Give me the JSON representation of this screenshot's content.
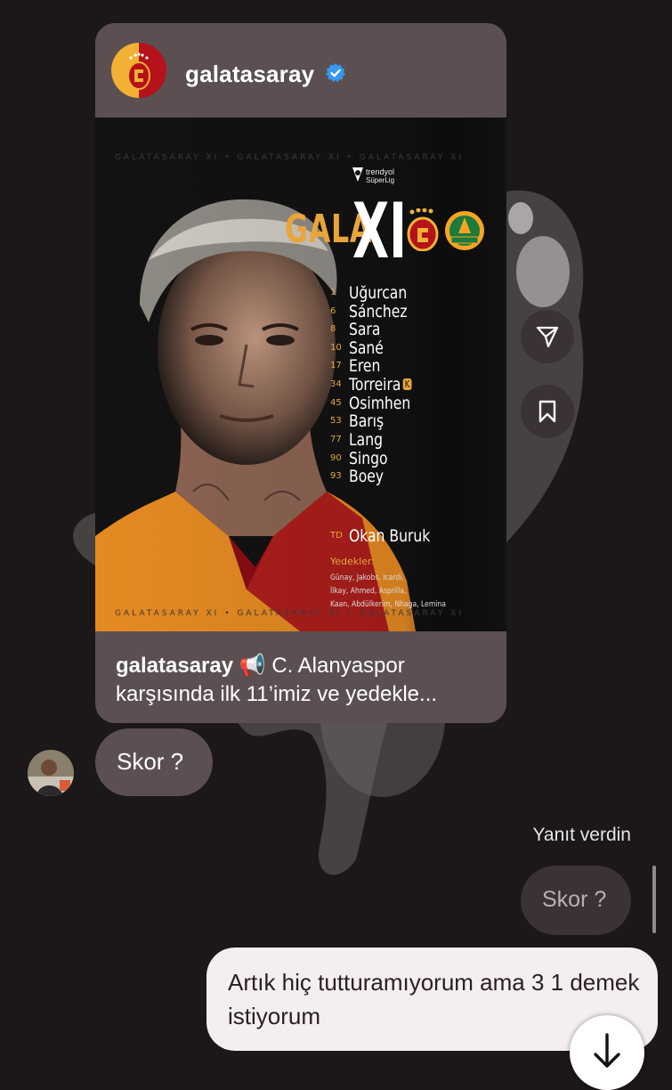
{
  "post": {
    "username": "galatasaray",
    "caption_user": "galatasaray",
    "caption_text": " 📢 C. Alanyaspor karşısında ilk 11’imiz ve yedekle..."
  },
  "graphic": {
    "watermark": "GALATASARAY XI   •   GALATASARAY XI   •   GALATASARAY XI",
    "league_line1": "trendyol",
    "league_line2": "SüperLig",
    "title_gala": "GALA",
    "title_xi": "XI",
    "away_crest_text": "ALANYASPOR",
    "lineup": [
      {
        "num": "1",
        "name": "Uğurcan"
      },
      {
        "num": "6",
        "name": "Sánchez"
      },
      {
        "num": "8",
        "name": "Sara"
      },
      {
        "num": "10",
        "name": "Sané"
      },
      {
        "num": "17",
        "name": "Eren"
      },
      {
        "num": "34",
        "name": "Torreira",
        "captain": "K"
      },
      {
        "num": "45",
        "name": "Osimhen"
      },
      {
        "num": "53",
        "name": "Barış"
      },
      {
        "num": "77",
        "name": "Lang"
      },
      {
        "num": "90",
        "name": "Singo"
      },
      {
        "num": "93",
        "name": "Boey"
      }
    ],
    "coach_label": "TD",
    "coach_name": "Okan Buruk",
    "subs_title": "Yedekler:",
    "subs": [
      "Günay, Jakobs, Icardi,",
      "İlkay, Ahmed, Asprilla,",
      "Kaan, Abdülkerim, Nhaga, Lemina"
    ],
    "colors": {
      "gold": "#e8a53a",
      "red": "#b5121b"
    }
  },
  "side_actions": [
    {
      "icon": "send-icon"
    },
    {
      "icon": "bookmark-icon"
    }
  ],
  "messages": {
    "incoming_text": "Skor ?",
    "reply_label": "Yanıt verdin",
    "reply_quote": "Skor ?",
    "outgoing_text": "Artık hiç tutturamıyorum ama 3 1 demek istiyorum"
  },
  "colors": {
    "background": "#1c1718",
    "bubble_incoming": "#5b4f52",
    "bubble_outgoing": "#f4eeef",
    "verified": "#3897f0"
  }
}
